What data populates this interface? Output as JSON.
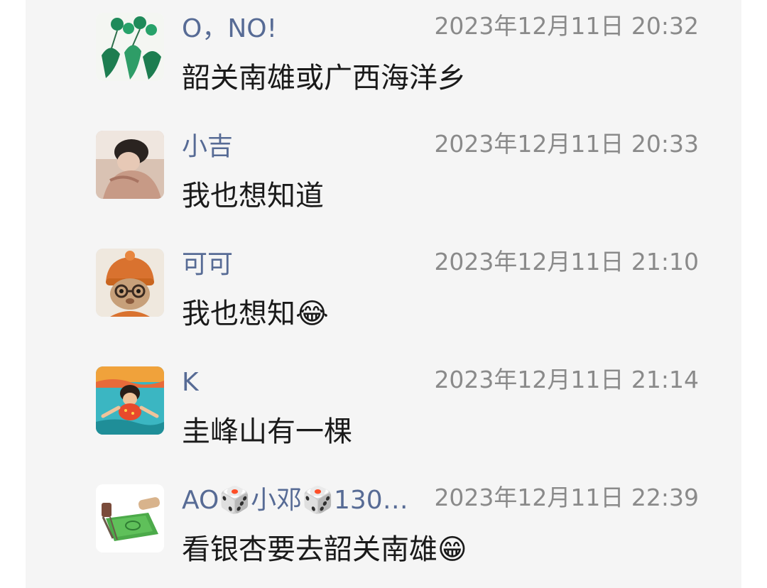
{
  "comments": [
    {
      "name": "O，NO!",
      "time": "2023年12月11日 20:32",
      "text": "韶关南雄或广西海洋乡",
      "avatar_icon": "green-tassel-earrings-icon"
    },
    {
      "name": "小吉",
      "time": "2023年12月11日 20:33",
      "text": "我也想知道",
      "avatar_icon": "girl-photo-icon"
    },
    {
      "name": "可可",
      "time": "2023年12月11日 21:10",
      "text": "我也想知😂",
      "avatar_icon": "plush-toy-with-glasses-icon"
    },
    {
      "name": "K",
      "time": "2023年12月11日 21:14",
      "text": "圭峰山有一棵",
      "avatar_icon": "swimming-child-icon"
    },
    {
      "name": "AO🎲小邓🎲130…",
      "time": "2023年12月11日 22:39",
      "text": "看银杏要去韶关南雄😁",
      "avatar_icon": "green-board-illustration-icon"
    }
  ],
  "colors": {
    "name": "#576b95",
    "time": "#8a8a8a",
    "text": "#1a1a1a",
    "panel_bg": "#f5f5f5"
  }
}
